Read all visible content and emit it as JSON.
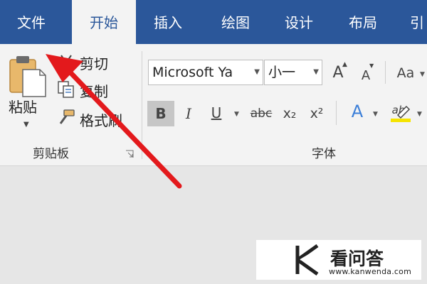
{
  "tabs": [
    {
      "label": "文件",
      "active": false
    },
    {
      "label": "开始",
      "active": true
    },
    {
      "label": "插入",
      "active": false
    },
    {
      "label": "绘图",
      "active": false
    },
    {
      "label": "设计",
      "active": false
    },
    {
      "label": "布局",
      "active": false
    },
    {
      "label": "引",
      "active": false
    }
  ],
  "clipboard": {
    "paste_label": "粘贴",
    "cut_label": "剪切",
    "copy_label": "复制",
    "format_painter_label": "格式刷",
    "group_label": "剪贴板"
  },
  "font": {
    "font_name": "Microsoft Ya",
    "font_size": "小一",
    "grow_label": "A",
    "shrink_label": "A",
    "change_case_label": "Aa",
    "bold_label": "B",
    "italic_label": "I",
    "underline_label": "U",
    "strikethrough_label": "abc",
    "subscript_label": "x₂",
    "superscript_label": "x²",
    "text_effects_label": "A",
    "highlight_label": "ab",
    "group_label": "字体"
  },
  "watermark": {
    "logo_letter": "K",
    "title": "看问答",
    "url": "www.kanwenda.com"
  },
  "colors": {
    "tab_bar": "#2b579a",
    "ribbon": "#f3f3f3",
    "annotation_arrow": "#e3191c",
    "highlight_yellow": "#f5e400",
    "text_effects_blue": "#3c7fd8"
  }
}
